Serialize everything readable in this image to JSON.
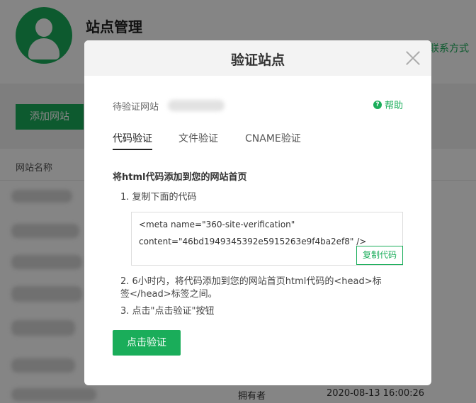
{
  "background": {
    "page_title": "站点管理",
    "contact_text": "联系方式",
    "add_site_label": "添加网站",
    "column_site_name": "网站名称",
    "owner_label": "拥有者",
    "date_text": "2020-08-13 16:00:26"
  },
  "modal": {
    "title": "验证站点",
    "site_label": "待验证网站",
    "help_label": "帮助",
    "tabs": [
      {
        "label": "代码验证",
        "active": true
      },
      {
        "label": "文件验证",
        "active": false
      },
      {
        "label": "CNAME验证",
        "active": false
      }
    ],
    "section_title": "将html代码添加到您的网站首页",
    "step1": "1. 复制下面的代码",
    "code_line1": "<meta name=\"360-site-verification\"",
    "code_line2": "content=\"46bd1949345392e5915263e9f4ba2ef8\" />",
    "copy_label": "复制代码",
    "step2": "2. 6小时内，将代码添加到您的网站首页html代码的<head>标签</head>标签之间。",
    "step3": "3. 点击\"点击验证\"按钮",
    "verify_label": "点击验证"
  },
  "colors": {
    "accent": "#1aad5a",
    "overlay": "rgba(0,0,0,0.48)"
  }
}
